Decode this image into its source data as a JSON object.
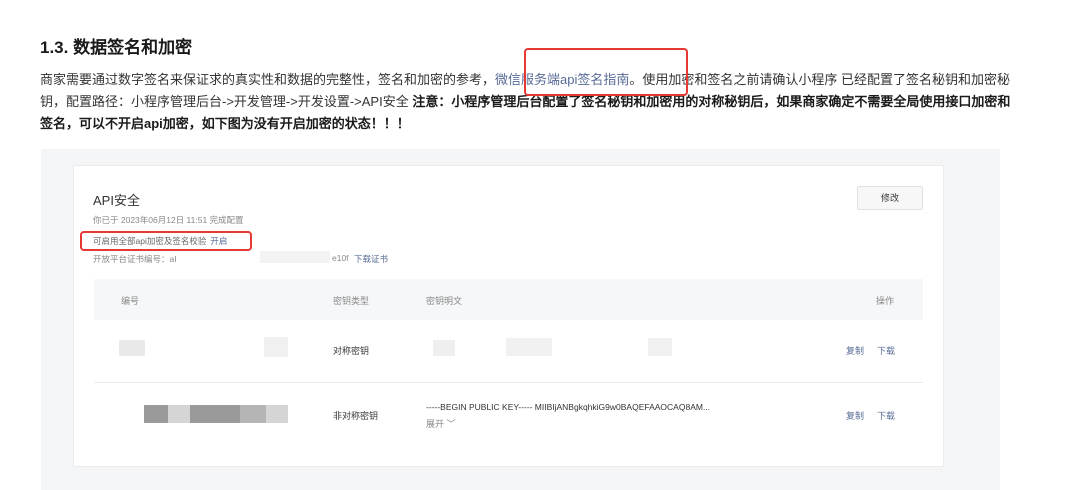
{
  "section": {
    "heading": "1.3. 数据签名和加密",
    "para_text1": "商家需要通过数字签名来保证求的真实性和数据的完整性，签名和加密的参考，",
    "para_link": "微信服务端api签名指南",
    "para_text2": "。使用加密和签名之前请确认小程序 已经配置了签名秘钥和加密秘钥，配置路径：小程序管理后台->开发管理->开发设置->API安全",
    "para_bold": " 注意：小程序管理后台配置了签名秘钥和加密用的对称秘钥后，如果商家确定不需要全局使用接口加密和签名，可以不开启api加密，如下图为没有开启加密的状态！！！"
  },
  "card": {
    "title": "API安全",
    "edit_label": "修改",
    "config_time": "你已于 2023年06月12日 11:51 完成配置",
    "enable_text": "可启用全部api加密及签名校验",
    "enable_action": "开启",
    "cert_label": "开放平台证书编号：aI",
    "cert_suffix": "e10f",
    "cert_download": "下载证书",
    "table": {
      "headers": [
        "编号",
        "密钥类型",
        "密钥明文",
        "操作"
      ],
      "rows": [
        {
          "type": "对称密钥",
          "plaintext": "",
          "copy": "复制",
          "download": "下载"
        },
        {
          "type": "非对称密钥",
          "plaintext": "-----BEGIN PUBLIC KEY----- MIIBIjANBgkqhkiG9w0BAQEFAAOCAQ8AM...",
          "expand": "展开 ﹀",
          "copy": "复制",
          "download": "下载"
        }
      ]
    }
  }
}
